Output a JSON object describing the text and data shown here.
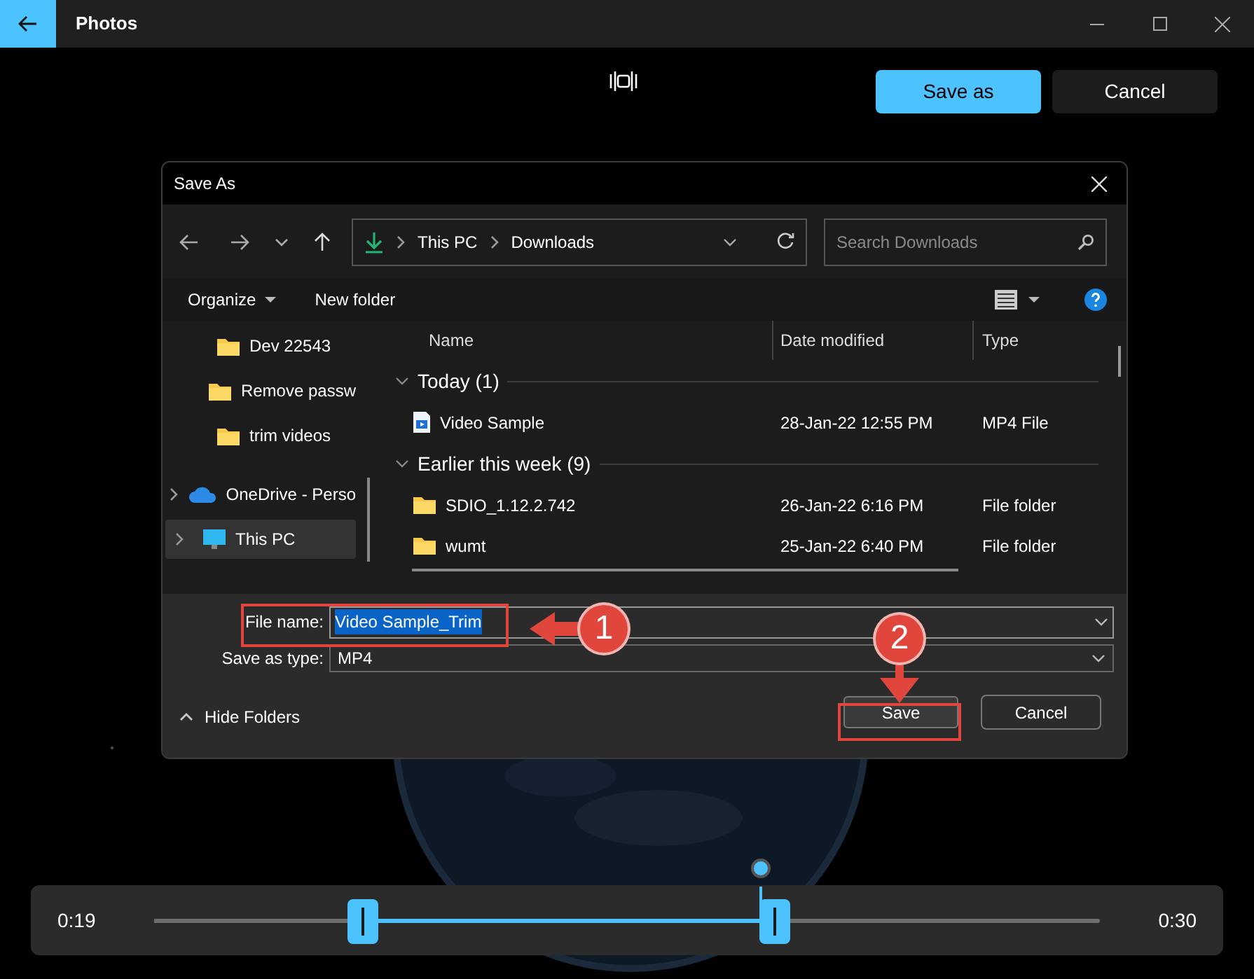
{
  "window": {
    "title": "Photos"
  },
  "toolbar": {
    "buttons": [
      {
        "label": "Save as",
        "primary": true
      },
      {
        "label": "Cancel",
        "primary": false
      }
    ]
  },
  "dialog": {
    "title": "Save As",
    "breadcrumb": [
      "This PC",
      "Downloads"
    ],
    "search": {
      "placeholder": "Search Downloads"
    },
    "commands": [
      "Organize",
      "New folder"
    ],
    "sidebar": [
      {
        "label": "Dev 22543",
        "kind": "folder",
        "expandable": false,
        "selected": false
      },
      {
        "label": "Remove passw",
        "kind": "folder",
        "expandable": false,
        "selected": false
      },
      {
        "label": "trim videos",
        "kind": "folder",
        "expandable": false,
        "selected": false
      },
      {
        "label": "OneDrive - Perso",
        "kind": "cloud",
        "expandable": true,
        "selected": false
      },
      {
        "label": "This PC",
        "kind": "pc",
        "expandable": true,
        "selected": true
      }
    ],
    "columns": [
      "Name",
      "Date modified",
      "Type"
    ],
    "groups": [
      {
        "label": "Today (1)",
        "rows": [
          {
            "name": "Video Sample",
            "kind": "video",
            "date": "28-Jan-22 12:55 PM",
            "type": "MP4 File"
          }
        ]
      },
      {
        "label": "Earlier this week (9)",
        "rows": [
          {
            "name": "SDIO_1.12.2.742",
            "kind": "folder",
            "date": "26-Jan-22 6:16 PM",
            "type": "File folder"
          },
          {
            "name": "wumt",
            "kind": "folder",
            "date": "25-Jan-22 6:40 PM",
            "type": "File folder"
          }
        ]
      }
    ],
    "file_name": {
      "label": "File name:",
      "value": "Video Sample_Trim"
    },
    "save_type": {
      "label": "Save as type:",
      "value": "MP4"
    },
    "hide_folders": "Hide Folders",
    "buttons": [
      "Save",
      "Cancel"
    ]
  },
  "markers": [
    "1",
    "2"
  ],
  "timeline": {
    "start_time": "0:19",
    "end_time": "0:30",
    "trim_start": {
      "level": 0.22
    },
    "trim_end": {
      "level": 0.656
    },
    "playhead": {
      "level": 0.641
    }
  }
}
